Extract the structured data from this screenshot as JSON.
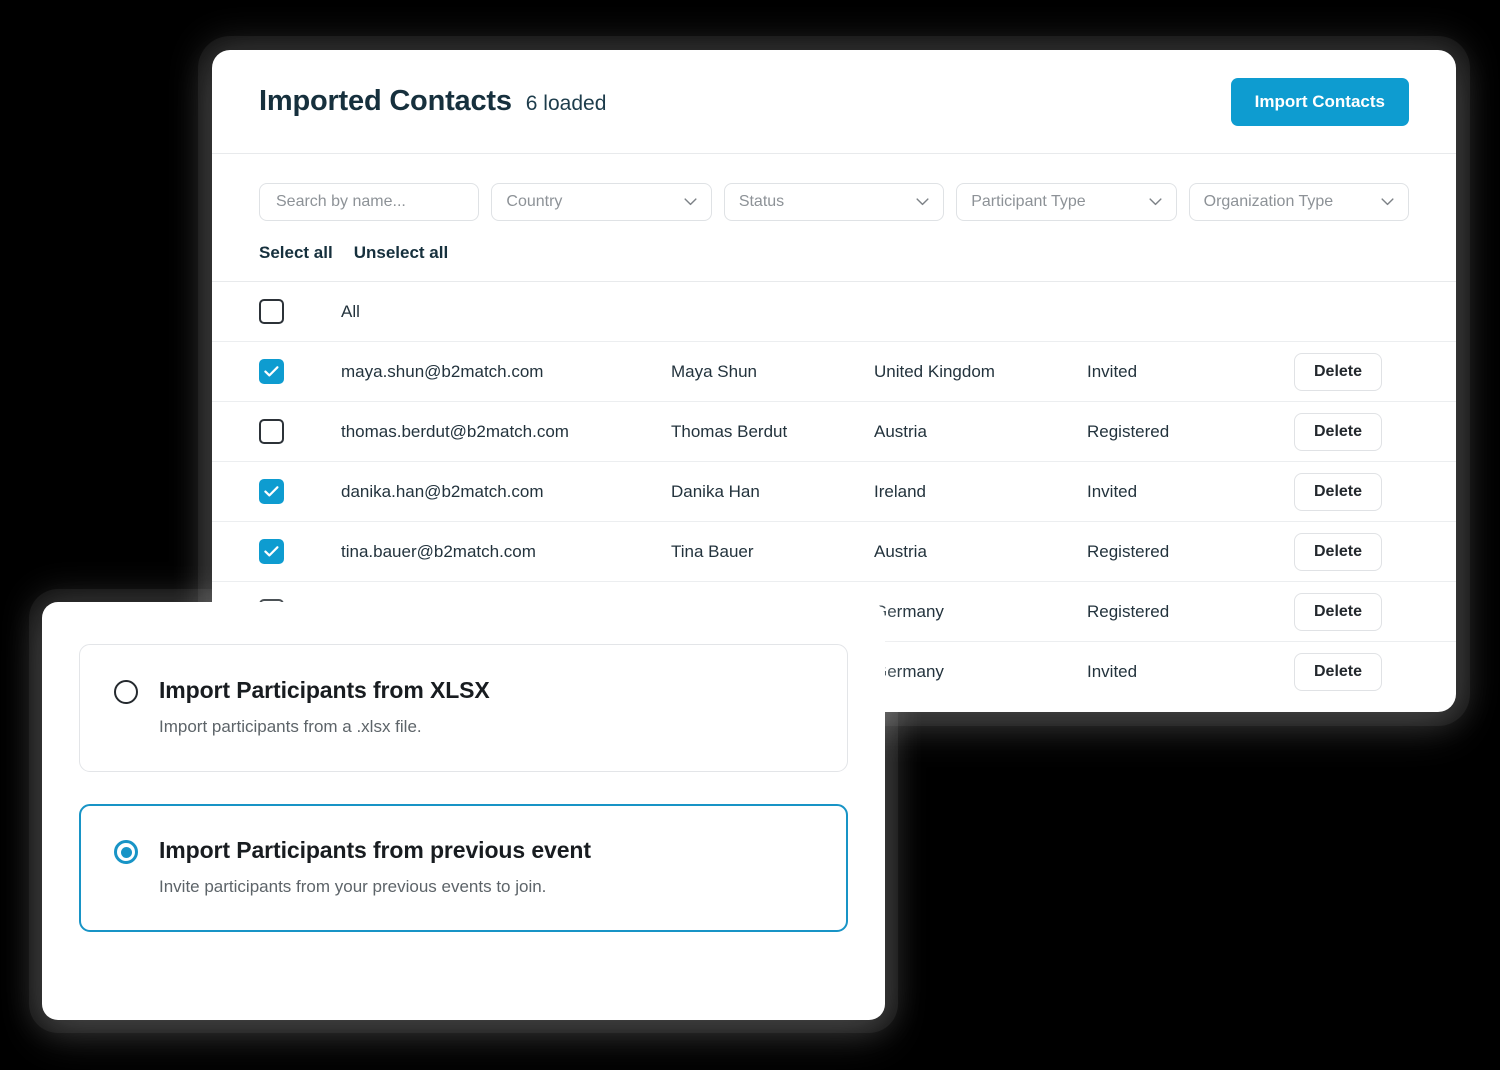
{
  "header": {
    "title": "Imported Contacts",
    "loaded_label": "6 loaded",
    "import_button": "Import Contacts"
  },
  "filters": {
    "search_placeholder": "Search by name...",
    "selects": [
      {
        "label": "Country"
      },
      {
        "label": "Status"
      },
      {
        "label": "Participant Type"
      },
      {
        "label": "Organization Type"
      }
    ]
  },
  "bulk_actions": {
    "select_all": "Select all",
    "unselect_all": "Unselect all"
  },
  "table": {
    "all_row": {
      "label": "All",
      "checked": false
    },
    "delete_label": "Delete",
    "rows": [
      {
        "checked": true,
        "email": "maya.shun@b2match.com",
        "name": "Maya Shun",
        "country": "United Kingdom",
        "status": "Invited"
      },
      {
        "checked": false,
        "email": "thomas.berdut@b2match.com",
        "name": "Thomas Berdut",
        "country": "Austria",
        "status": "Registered"
      },
      {
        "checked": true,
        "email": "danika.han@b2match.com",
        "name": "Danika Han",
        "country": "Ireland",
        "status": "Invited"
      },
      {
        "checked": true,
        "email": "tina.bauer@b2match.com",
        "name": "Tina Bauer",
        "country": "Austria",
        "status": "Registered"
      },
      {
        "checked": false,
        "email": "",
        "name": "",
        "country": "Germany",
        "status": "Registered"
      },
      {
        "checked": false,
        "email": "",
        "name": "",
        "country": "Germany",
        "status": "Invited"
      }
    ]
  },
  "import_modal": {
    "options": [
      {
        "title": "Import Participants from XLSX",
        "description": "Import participants from a .xlsx file.",
        "selected": false
      },
      {
        "title": "Import Participants from previous event",
        "description": "Invite participants from your previous events to join.",
        "selected": true
      }
    ]
  },
  "colors": {
    "accent": "#0e9cd0",
    "accent_border": "#1894c6",
    "title": "#16303d",
    "background": "#000000"
  }
}
